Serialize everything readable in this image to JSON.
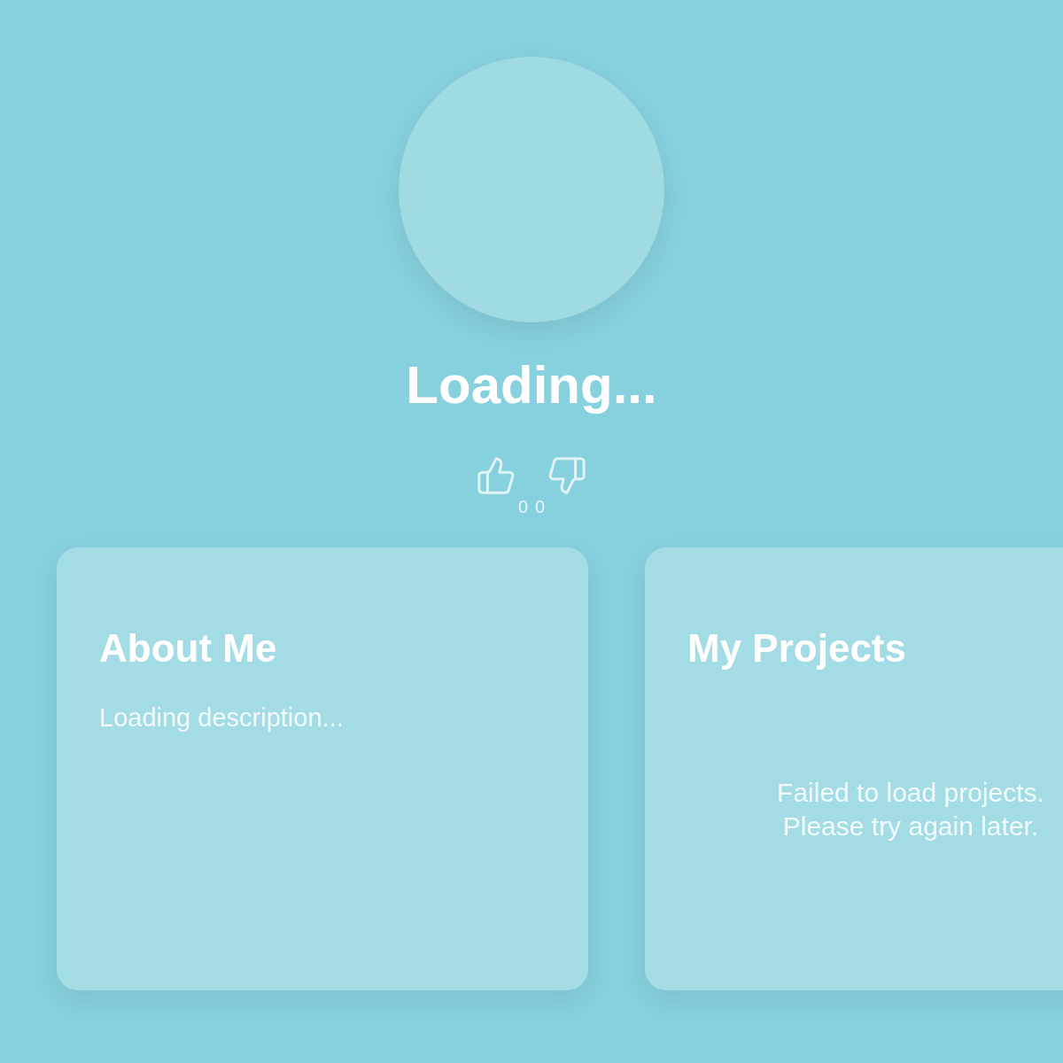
{
  "profile": {
    "name": "Loading...",
    "likes": "0",
    "dislikes": "0"
  },
  "cards": [
    {
      "title": "About Me",
      "text": "Loading description...",
      "kind": "text"
    },
    {
      "title": "My Projects",
      "text": "Failed to load projects.\nPlease try again later.",
      "kind": "error"
    }
  ]
}
